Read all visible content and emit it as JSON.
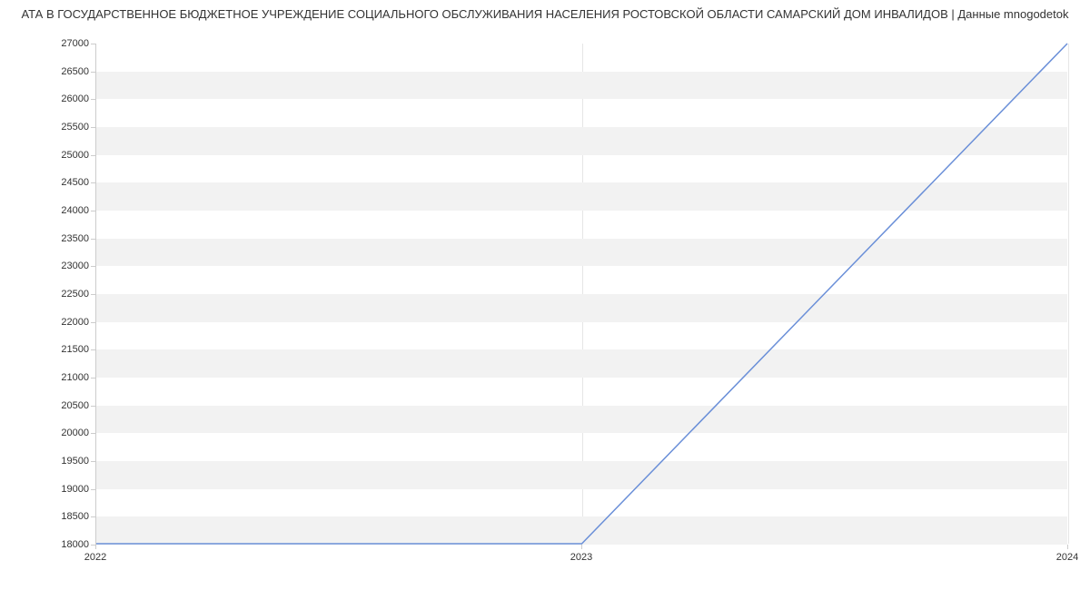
{
  "chart_data": {
    "type": "line",
    "title": "АТА В ГОСУДАРСТВЕННОЕ БЮДЖЕТНОЕ УЧРЕЖДЕНИЕ СОЦИАЛЬНОГО ОБСЛУЖИВАНИЯ НАСЕЛЕНИЯ РОСТОВСКОЙ ОБЛАСТИ САМАРСКИЙ ДОМ ИНВАЛИДОВ | Данные mnogodetok",
    "x": [
      2022,
      2023,
      2024
    ],
    "values": [
      18000,
      18000,
      27000
    ],
    "xlabel": "",
    "ylabel": "",
    "ylim": [
      18000,
      27000
    ],
    "xlim": [
      2022,
      2024
    ],
    "y_ticks": [
      18000,
      18500,
      19000,
      19500,
      20000,
      20500,
      21000,
      21500,
      22000,
      22500,
      23000,
      23500,
      24000,
      24500,
      25000,
      25500,
      26000,
      26500,
      27000
    ],
    "x_ticks": [
      2022,
      2023,
      2024
    ],
    "line_color": "#6a8fd8"
  }
}
